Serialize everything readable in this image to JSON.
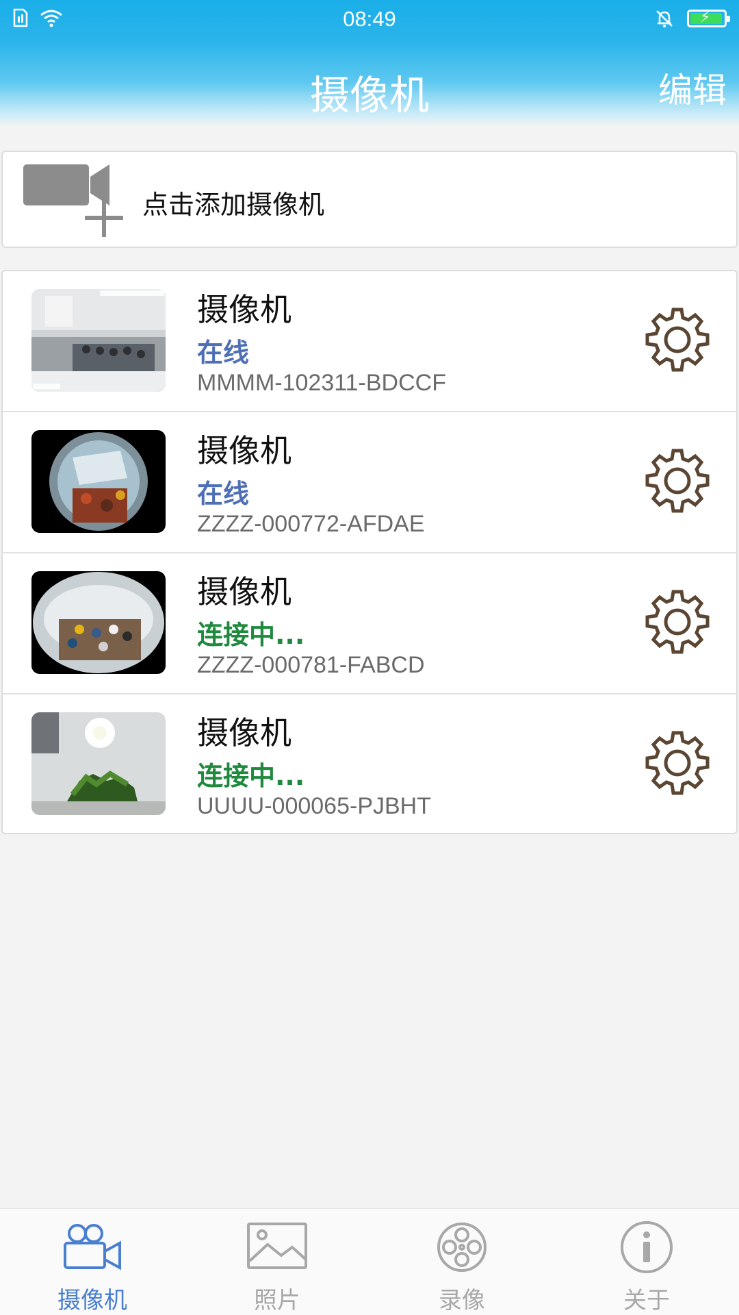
{
  "status_bar": {
    "time": "08:49"
  },
  "header": {
    "title": "摄像机",
    "edit_label": "编辑"
  },
  "add_camera": {
    "label": "点击添加摄像机"
  },
  "cameras": [
    {
      "name": "摄像机",
      "status": "在线",
      "status_color": "#4e6fb5",
      "id": "MMMM-102311-BDCCF"
    },
    {
      "name": "摄像机",
      "status": "在线",
      "status_color": "#4e6fb5",
      "id": "ZZZZ-000772-AFDAE"
    },
    {
      "name": "摄像机",
      "status": "连接中...",
      "status_color": "#1f8a3e",
      "id": "ZZZZ-000781-FABCD"
    },
    {
      "name": "摄像机",
      "status": "连接中...",
      "status_color": "#1f8a3e",
      "id": "UUUU-000065-PJBHT"
    }
  ],
  "tabs": [
    {
      "label": "摄像机",
      "icon": "camera-icon",
      "active": true
    },
    {
      "label": "照片",
      "icon": "photo-icon",
      "active": false
    },
    {
      "label": "录像",
      "icon": "film-reel-icon",
      "active": false
    },
    {
      "label": "关于",
      "icon": "info-icon",
      "active": false
    }
  ],
  "colors": {
    "accent": "#4a7fd0",
    "header": "#1aaee8",
    "gear": "#5a4632"
  }
}
